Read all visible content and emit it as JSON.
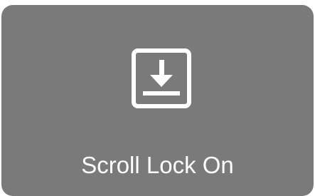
{
  "osd": {
    "icon": "scroll-lock-icon",
    "status_text": "Scroll Lock On",
    "background_color": "#7a7a7a",
    "foreground_color": "#ffffff"
  }
}
